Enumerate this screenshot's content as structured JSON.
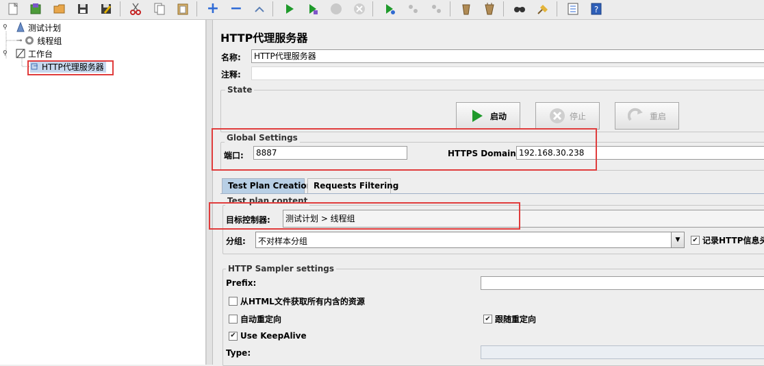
{
  "toolbar": {
    "buttons": [
      "new-icon",
      "templates-icon",
      "open-icon",
      "save-icon",
      "save-as-icon",
      "cut-icon",
      "copy-icon",
      "paste-icon",
      "expand-icon",
      "collapse-icon",
      "toggle-icon",
      "start-icon",
      "start-no-pause-icon",
      "stop-icon",
      "shutdown-icon",
      "remote-start-icon",
      "remote-stop-icon",
      "remote-shutdown-icon",
      "clear-icon",
      "clear-all-icon",
      "search-icon",
      "reset-search-icon",
      "function-helper-icon",
      "help-icon"
    ]
  },
  "tree": {
    "test_plan": "测试计划",
    "thread_group": "线程组",
    "workbench": "工作台",
    "proxy_server": "HTTP代理服务器"
  },
  "panel": {
    "title": "HTTP代理服务器",
    "name_label": "名称:",
    "name_value": "HTTP代理服务器",
    "comment_label": "注释:",
    "comment_value": ""
  },
  "state": {
    "title": "State",
    "start_label": "启动",
    "stop_label": "停止",
    "restart_label": "重启"
  },
  "global": {
    "title": "Global Settings",
    "port_label": "端口:",
    "port_value": "8887",
    "https_label": "HTTPS Domains :",
    "https_value": "192.168.30.238"
  },
  "tabs": {
    "creation": "Test Plan Creation",
    "filtering": "Requests Filtering"
  },
  "content": {
    "title": "Test plan content",
    "target_label": "目标控制器:",
    "target_value": "测试计划 > 线程组",
    "group_label": "分组:",
    "group_value": "不对样本分组",
    "record_label": "记录HTTP信息头"
  },
  "sampler": {
    "title": "HTTP Sampler settings",
    "prefix_label": "Prefix:",
    "prefix_value": "",
    "retrieve_label": "从HTML文件获取所有内含的资源",
    "auto_redirect_label": "自动重定向",
    "follow_redirect_label": "跟随重定向",
    "keepalive_label": "Use KeepAlive",
    "type_label": "Type:",
    "type_value": ""
  },
  "checkbox_states": {
    "record": true,
    "retrieve": false,
    "auto_redirect": false,
    "follow_redirect": true,
    "keepalive": true
  },
  "colors": {
    "highlight_red": "#e03b3b",
    "selection": "#c7d8ee",
    "tab_active": "#b8cfe5"
  }
}
